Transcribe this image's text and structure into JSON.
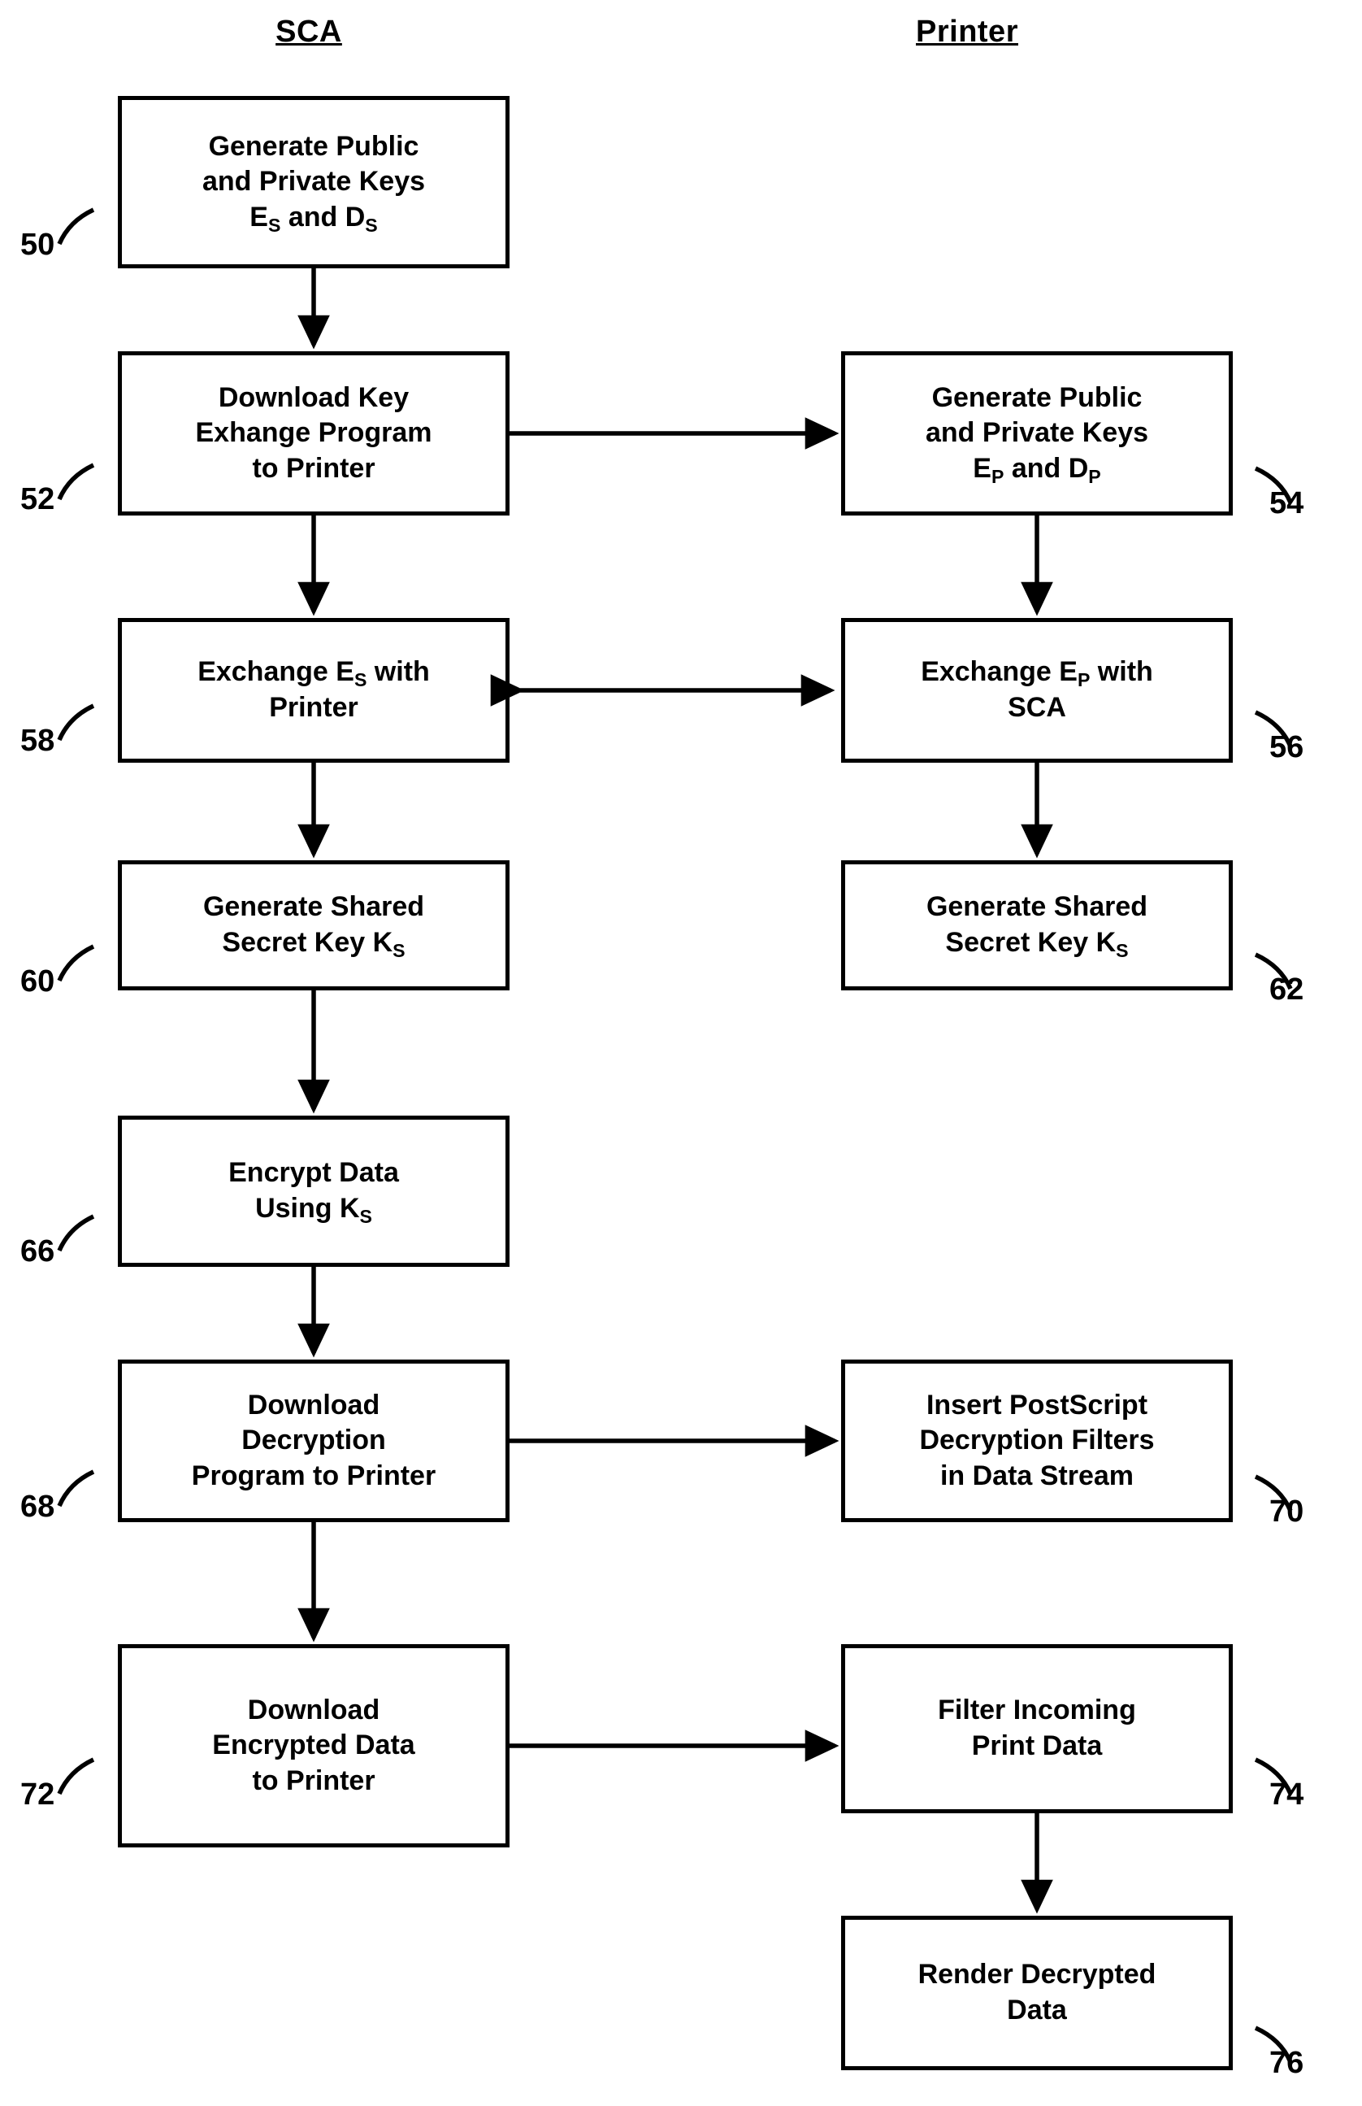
{
  "diagram": {
    "columns": [
      {
        "id": "sca",
        "label": "SCA"
      },
      {
        "id": "printer",
        "label": "Printer"
      }
    ],
    "nodes": [
      {
        "id": "n50",
        "ref": "50",
        "column": "sca",
        "lines": [
          "Generate Public",
          "and Private Keys",
          "E<sub>S</sub> and D<sub>S</sub>"
        ]
      },
      {
        "id": "n52",
        "ref": "52",
        "column": "sca",
        "lines": [
          "Download Key",
          "Exhange Program",
          "to Printer"
        ]
      },
      {
        "id": "n54",
        "ref": "54",
        "column": "printer",
        "lines": [
          "Generate Public",
          "and Private Keys",
          "E<sub>P</sub> and D<sub>P</sub>"
        ]
      },
      {
        "id": "n58",
        "ref": "58",
        "column": "sca",
        "lines": [
          "Exchange E<sub>S</sub> with",
          "Printer"
        ]
      },
      {
        "id": "n56",
        "ref": "56",
        "column": "printer",
        "lines": [
          "Exchange E<sub>P</sub> with",
          "SCA"
        ]
      },
      {
        "id": "n60",
        "ref": "60",
        "column": "sca",
        "lines": [
          "Generate Shared",
          "Secret Key K<sub>S</sub>"
        ]
      },
      {
        "id": "n62",
        "ref": "62",
        "column": "printer",
        "lines": [
          "Generate Shared",
          "Secret Key K<sub>S</sub>"
        ]
      },
      {
        "id": "n66",
        "ref": "66",
        "column": "sca",
        "lines": [
          "Encrypt Data",
          "Using K<sub>S</sub>"
        ]
      },
      {
        "id": "n68",
        "ref": "68",
        "column": "sca",
        "lines": [
          "Download",
          "Decryption",
          "Program to Printer"
        ]
      },
      {
        "id": "n70",
        "ref": "70",
        "column": "printer",
        "lines": [
          "Insert PostScript",
          "Decryption Filters",
          "in Data Stream"
        ]
      },
      {
        "id": "n72",
        "ref": "72",
        "column": "sca",
        "lines": [
          "Download",
          "Encrypted Data",
          "to Printer"
        ]
      },
      {
        "id": "n74",
        "ref": "74",
        "column": "printer",
        "lines": [
          "Filter Incoming",
          "Print Data"
        ]
      },
      {
        "id": "n76",
        "ref": "76",
        "column": "printer",
        "lines": [
          "Render Decrypted",
          "Data"
        ]
      }
    ]
  }
}
